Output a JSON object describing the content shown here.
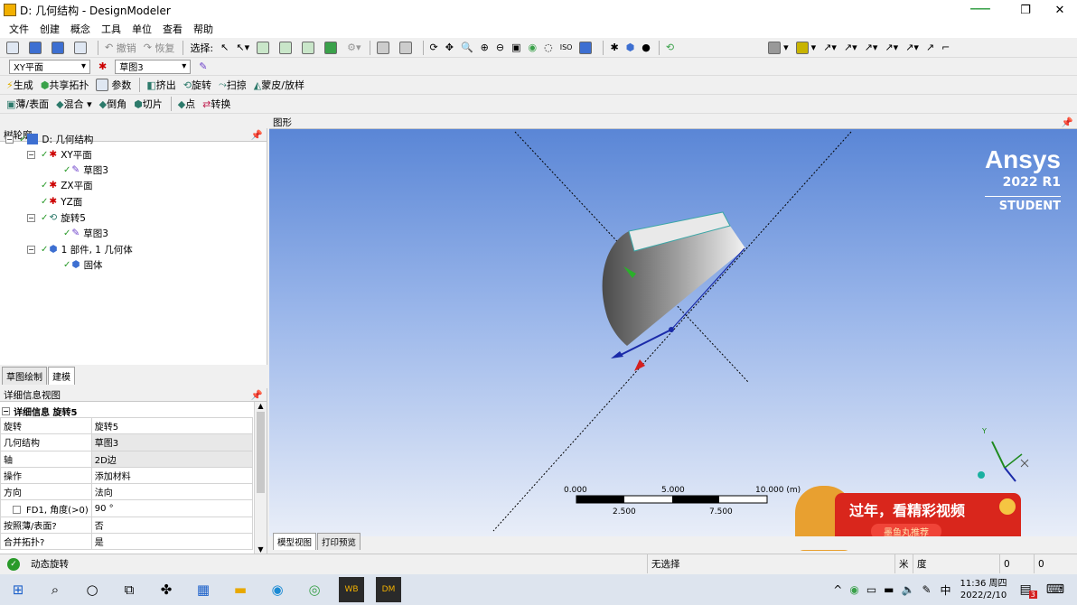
{
  "window": {
    "title": "D: 几何结构 - DesignModeler",
    "min": "━━━━",
    "restore": "❐",
    "close": "✕"
  },
  "menu": [
    "文件",
    "创建",
    "概念",
    "工具",
    "单位",
    "查看",
    "帮助"
  ],
  "toolbar1": {
    "undo": "撤销",
    "redo": "恢复",
    "select_label": "选择:"
  },
  "toolbar2": {
    "plane": "XY平面",
    "sketch": "草图3"
  },
  "toolbar3": [
    "生成",
    "共享拓扑",
    "参数",
    "挤出",
    "旋转",
    "扫掠",
    "蒙皮/放样"
  ],
  "toolbar4": [
    "薄/表面",
    "混合",
    "倒角",
    "切片",
    "点",
    "转换"
  ],
  "tree": {
    "header": "树轮廓",
    "pin": "ꟷ",
    "nodes": [
      {
        "label": "D: 几何结构"
      },
      {
        "label": "XY平面"
      },
      {
        "label": "草图3"
      },
      {
        "label": "ZX平面"
      },
      {
        "label": "YZ面"
      },
      {
        "label": "旋转5"
      },
      {
        "label": "草图3"
      },
      {
        "label": "1 部件, 1 几何体"
      },
      {
        "label": "固体"
      }
    ],
    "tabs": [
      "草图绘制",
      "建模"
    ]
  },
  "details": {
    "header": "详细信息视图",
    "section": "详细信息 旋转5",
    "rows": [
      {
        "k": "旋转",
        "v": "旋转5"
      },
      {
        "k": "几何结构",
        "v": "草图3"
      },
      {
        "k": "轴",
        "v": "2D边"
      },
      {
        "k": "操作",
        "v": "添加材料"
      },
      {
        "k": "方向",
        "v": "法向"
      },
      {
        "k": "FD1, 角度(>0)",
        "v": "90 °"
      },
      {
        "k": "按照薄/表面?",
        "v": "否"
      },
      {
        "k": "合并拓扑?",
        "v": "是"
      }
    ]
  },
  "graphics": {
    "header": "图形",
    "brand": {
      "name": "Ansys",
      "version": "2022 R1",
      "edition": "STUDENT"
    },
    "scale": {
      "top": [
        "0.000",
        "5.000",
        "10.000 (m)"
      ],
      "bottom": [
        "2.500",
        "7.500"
      ]
    },
    "triad": {
      "y": "Y"
    },
    "tabs": [
      "模型视图",
      "打印预览"
    ],
    "promo": {
      "headline": "过年，看精彩视频",
      "sub": "墨鱼丸推荐"
    }
  },
  "status": {
    "message": "动态旋转",
    "selection": "无选择",
    "units": "米",
    "angle": "度",
    "v1": "0",
    "v2": "0"
  },
  "taskbar": {
    "time": "11:36 周四",
    "date": "2022/2/10",
    "ime": "中",
    "badge": "3"
  },
  "colors": {
    "accent": "#3d6fd1",
    "ok": "#2a9a2a",
    "promo": "#d9261c"
  }
}
